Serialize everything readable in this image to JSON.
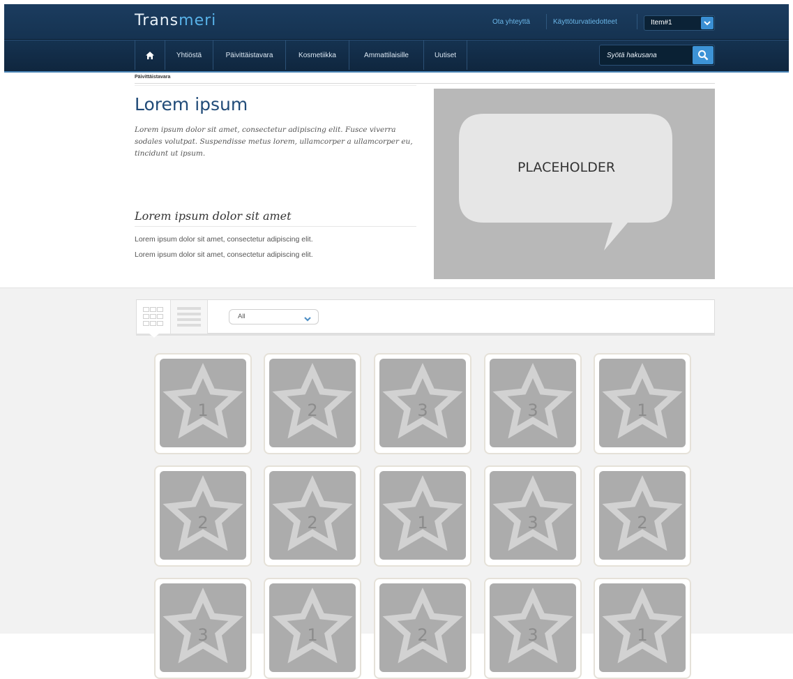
{
  "brand": {
    "logo_main": "Trans",
    "logo_accent": "meri"
  },
  "header": {
    "links": [
      "Ota yhteyttä",
      "Käyttöturvatiedotteet"
    ],
    "item_select_value": "Item#1",
    "search_placeholder": "Syötä hakusana",
    "colors": {
      "bar": "#153250",
      "accent": "#3d93d6"
    }
  },
  "nav": {
    "home_icon": "home-icon",
    "items": [
      "Yhtiöstä",
      "Päivittäistavara",
      "Kosmetiikka",
      "Ammattilaisille",
      "Uutiset"
    ]
  },
  "breadcrumb": "Päivittäistavara",
  "hero": {
    "title": "Lorem ipsum",
    "intro": "Lorem ipsum dolor sit amet, consectetur adipiscing elit. Fusce viverra sodales volutpat. Suspendisse metus lorem, ullamcorper a ullamcorper eu, tincidunt ut ipsum.",
    "subtitle": "Lorem ipsum dolor sit amet",
    "lines": [
      "Lorem ipsum dolor sit amet, consectetur adipiscing elit.",
      "Lorem ipsum dolor sit amet, consectetur adipiscing elit."
    ],
    "placeholder_text": "PLACEHOLDER"
  },
  "toolbar": {
    "view_icons": [
      "grid-view-icon",
      "list-view-icon"
    ],
    "filter_value": "All"
  },
  "products": [
    [
      "1",
      "2",
      "3",
      "3",
      "1"
    ],
    [
      "2",
      "2",
      "1",
      "3",
      "2"
    ],
    [
      "3",
      "1",
      "2",
      "3",
      "1"
    ]
  ]
}
